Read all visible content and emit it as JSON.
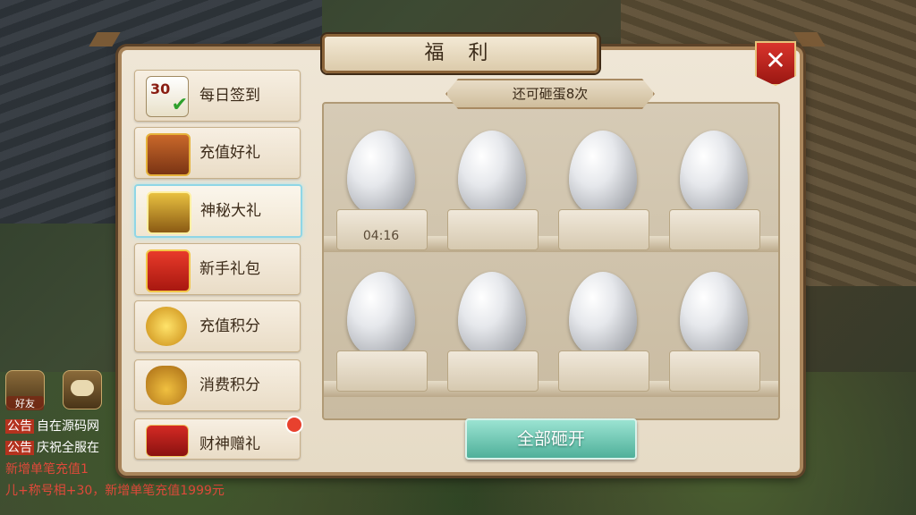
{
  "panel": {
    "title": "福  利",
    "close_icon": "close-icon"
  },
  "sidebar": {
    "items": [
      {
        "label": "每日签到",
        "icon": "calendar-check-icon",
        "icon_text": "30",
        "active": false
      },
      {
        "label": "充值好礼",
        "icon": "treasure-chest-icon",
        "active": false
      },
      {
        "label": "神秘大礼",
        "icon": "gold-chest-icon",
        "active": true
      },
      {
        "label": "新手礼包",
        "icon": "gift-box-icon",
        "active": false
      },
      {
        "label": "充值积分",
        "icon": "gold-ingots-icon",
        "active": false
      },
      {
        "label": "消费积分",
        "icon": "money-bag-icon",
        "active": false
      },
      {
        "label": "财神赠礼",
        "icon": "red-envelope-icon",
        "active": false,
        "badge": true
      }
    ]
  },
  "content": {
    "remaining_text": "还可砸蛋8次",
    "eggs": [
      {
        "timer": "04:16"
      },
      {
        "timer": ""
      },
      {
        "timer": ""
      },
      {
        "timer": ""
      },
      {
        "timer": ""
      },
      {
        "timer": ""
      },
      {
        "timer": ""
      },
      {
        "timer": ""
      }
    ],
    "open_all_label": "全部砸开"
  },
  "hud": {
    "friend_label": "好友",
    "chat_icon": "chat-bubble-icon",
    "chat_lines": [
      {
        "tag": "公告",
        "text": "自在源码网"
      },
      {
        "tag": "公告",
        "text": "庆祝全服在"
      },
      {
        "tag": "",
        "text": "新增单笔充值1"
      },
      {
        "tag": "",
        "text": "儿+称号相+30，新增单笔充值1999元"
      }
    ]
  },
  "colors": {
    "accent_button": "#4fb09a",
    "close_button": "#d9342c",
    "active_item_border": "#8fd6e6",
    "announcement_red": "#e0493a"
  }
}
